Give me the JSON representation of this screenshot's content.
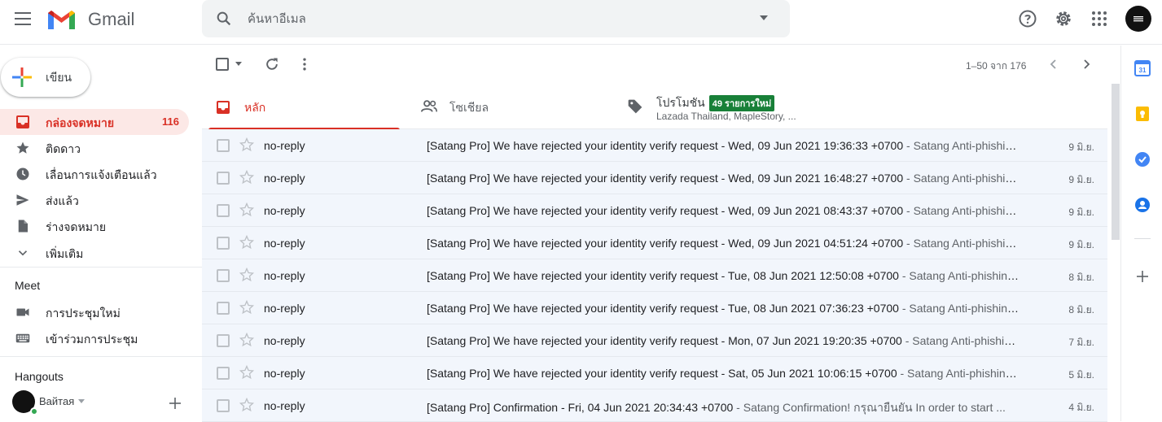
{
  "header": {
    "app_name": "Gmail",
    "search_placeholder": "ค้นหาอีเมล",
    "icons": [
      "menu-icon",
      "search-icon",
      "search-options-icon",
      "help-icon",
      "settings-icon",
      "apps-icon",
      "account-avatar"
    ]
  },
  "compose": {
    "label": "เขียน"
  },
  "nav": {
    "items": [
      {
        "label": "กล่องจดหมาย",
        "count": "116",
        "icon": "inbox-icon",
        "active": true
      },
      {
        "label": "ติดดาว",
        "icon": "star-icon"
      },
      {
        "label": "เลื่อนการแจ้งเตือนแล้ว",
        "icon": "clock-icon"
      },
      {
        "label": "ส่งแล้ว",
        "icon": "send-icon"
      },
      {
        "label": "ร่างจดหมาย",
        "icon": "draft-icon"
      },
      {
        "label": "เพิ่มเติม",
        "icon": "chevron-down-icon"
      }
    ],
    "meet": {
      "title": "Meet",
      "items": [
        {
          "label": "การประชุมใหม่",
          "icon": "video-icon"
        },
        {
          "label": "เข้าร่วมการประชุม",
          "icon": "keyboard-icon"
        }
      ]
    },
    "hangouts": {
      "title": "Hangouts",
      "user": "Вайтая"
    }
  },
  "toolbar": {
    "pagination": "1–50 จาก 176"
  },
  "tabs": [
    {
      "label": "หลัก",
      "active": true
    },
    {
      "label": "โซเชียล"
    },
    {
      "label": "โปรโมชัน",
      "badge": "49 รายการใหม่",
      "sub": "Lazada Thailand, MapleStory, ..."
    }
  ],
  "emails": [
    {
      "sender": "no-reply",
      "subject": "[Satang Pro] We have rejected your identity verify request - Wed, 09 Jun 2021 19:36:33 +0700",
      "snippet": " - Satang Anti-phishing code: ...",
      "date": "9 มิ.ย."
    },
    {
      "sender": "no-reply",
      "subject": "[Satang Pro] We have rejected your identity verify request - Wed, 09 Jun 2021 16:48:27 +0700",
      "snippet": " - Satang Anti-phishing code: ...",
      "date": "9 มิ.ย."
    },
    {
      "sender": "no-reply",
      "subject": "[Satang Pro] We have rejected your identity verify request - Wed, 09 Jun 2021 08:43:37 +0700",
      "snippet": " - Satang Anti-phishing code: ...",
      "date": "9 มิ.ย."
    },
    {
      "sender": "no-reply",
      "subject": "[Satang Pro] We have rejected your identity verify request - Wed, 09 Jun 2021 04:51:24 +0700",
      "snippet": " - Satang Anti-phishing code: ...",
      "date": "9 มิ.ย."
    },
    {
      "sender": "no-reply",
      "subject": "[Satang Pro] We have rejected your identity verify request - Tue, 08 Jun 2021 12:50:08 +0700",
      "snippet": " - Satang Anti-phishing code: ...",
      "date": "8 มิ.ย."
    },
    {
      "sender": "no-reply",
      "subject": "[Satang Pro] We have rejected your identity verify request - Tue, 08 Jun 2021 07:36:23 +0700",
      "snippet": " - Satang Anti-phishing code: ...",
      "date": "8 มิ.ย."
    },
    {
      "sender": "no-reply",
      "subject": "[Satang Pro] We have rejected your identity verify request - Mon, 07 Jun 2021 19:20:35 +0700",
      "snippet": " - Satang Anti-phishing code: ...",
      "date": "7 มิ.ย."
    },
    {
      "sender": "no-reply",
      "subject": "[Satang Pro] We have rejected your identity verify request - Sat, 05 Jun 2021 10:06:15 +0700",
      "snippet": " - Satang Anti-phishing code: ...",
      "date": "5 มิ.ย."
    },
    {
      "sender": "no-reply",
      "subject": "[Satang Pro] Confirmation - Fri, 04 Jun 2021 20:34:43 +0700",
      "snippet": " - Satang Confirmation! กรุณายืนยัน In order to start ...",
      "date": "4 มิ.ย."
    }
  ],
  "colors": {
    "accent": "#d93025",
    "badge": "#188038",
    "row_bg": "#f2f6fc"
  }
}
